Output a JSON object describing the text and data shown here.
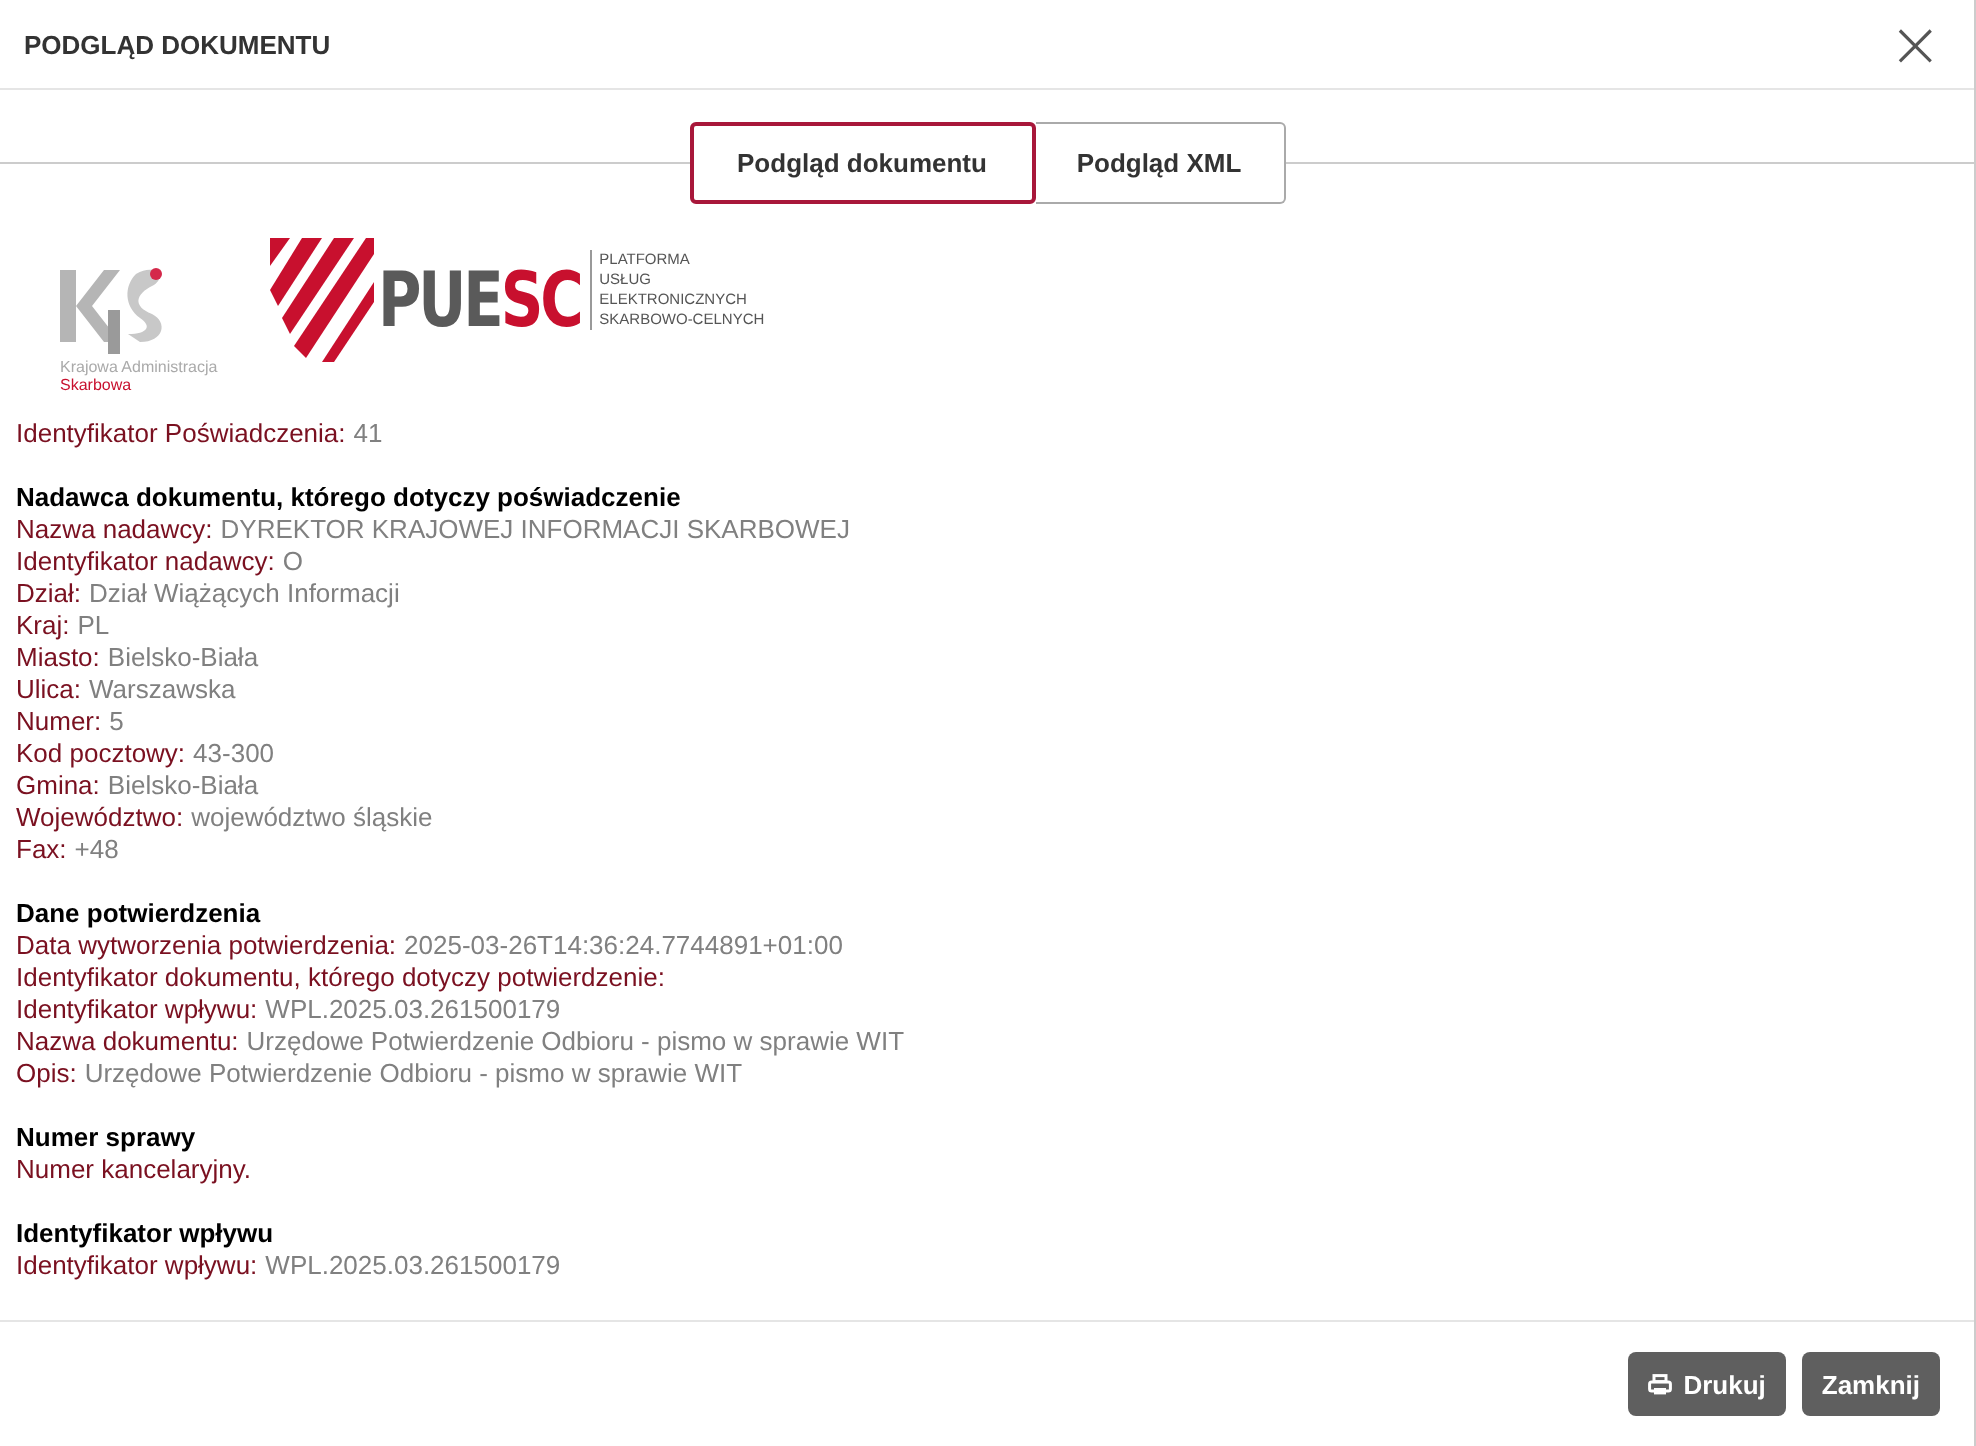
{
  "dialog": {
    "title": "PODGLĄD DOKUMENTU",
    "close": "×"
  },
  "tabs": [
    {
      "label": "Podgląd dokumentu",
      "selected": true
    },
    {
      "label": "Podgląd XML",
      "selected": false
    }
  ],
  "logos": {
    "kas": {
      "line1": "Krajowa Administracja",
      "line2": "Skarbowa"
    },
    "puesc": {
      "name_a": "PUE",
      "name_b": "SC",
      "lines": [
        "PLATFORMA",
        "USŁUG",
        "ELEKTRONICZNYCH",
        "SKARBOWO-CELNYCH"
      ]
    }
  },
  "sections": [
    {
      "fields": [
        {
          "label": "Identyfikator Poświadczenia:",
          "value": "41"
        }
      ]
    },
    {
      "heading": "Nadawca dokumentu, którego dotyczy poświadczenie",
      "fields": [
        {
          "label": "Nazwa nadawcy:",
          "value": "DYREKTOR KRAJOWEJ INFORMACJI SKARBOWEJ"
        },
        {
          "label": "Identyfikator nadawcy:",
          "value": "O"
        },
        {
          "label": "Dział:",
          "value": "Dział Wiążących Informacji"
        },
        {
          "label": "Kraj:",
          "value": "PL"
        },
        {
          "label": "Miasto:",
          "value": "Bielsko-Biała"
        },
        {
          "label": "Ulica:",
          "value": "Warszawska"
        },
        {
          "label": "Numer:",
          "value": "5"
        },
        {
          "label": "Kod pocztowy:",
          "value": "43-300"
        },
        {
          "label": "Gmina:",
          "value": "Bielsko-Biała"
        },
        {
          "label": "Województwo:",
          "value": "województwo śląskie"
        },
        {
          "label": "Fax:",
          "value": "+48"
        }
      ]
    },
    {
      "heading": "Dane potwierdzenia",
      "fields": [
        {
          "label": "Data wytworzenia potwierdzenia:",
          "value": "2025-03-26T14:36:24.7744891+01:00"
        },
        {
          "label": "Identyfikator dokumentu, którego dotyczy potwierdzenie:"
        },
        {
          "label": "Identyfikator wpływu:",
          "value": "WPL.2025.03.261500179"
        },
        {
          "label": "Nazwa dokumentu:",
          "value": "Urzędowe Potwierdzenie Odbioru - pismo w sprawie WIT"
        },
        {
          "label": "Opis:",
          "value": "Urzędowe Potwierdzenie Odbioru - pismo w sprawie WIT"
        }
      ]
    },
    {
      "heading": "Numer sprawy",
      "fields": [
        {
          "label": "Numer kancelaryjny."
        }
      ]
    },
    {
      "heading": "Identyfikator wpływu",
      "fields": [
        {
          "label": "Identyfikator wpływu:",
          "value": "WPL.2025.03.261500179"
        }
      ]
    }
  ],
  "buttons": [
    {
      "label": "Drukuj",
      "kind": "print"
    },
    {
      "label": "Zamknij",
      "kind": "plain"
    }
  ]
}
